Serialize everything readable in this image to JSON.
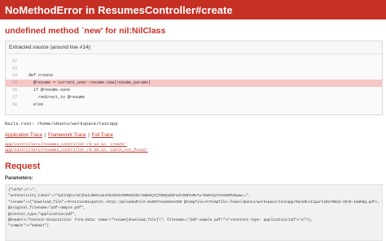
{
  "header": {
    "title": "NoMethodError in ResumesController#create"
  },
  "error": {
    "message": "undefined method `new' for nil:NilClass"
  },
  "source": {
    "title": "Extracted source (around line #14):",
    "lines": [
      {
        "num": "12",
        "code": ""
      },
      {
        "num": "13",
        "code": ""
      },
      {
        "num": "14",
        "code": "  def create"
      },
      {
        "num": "15",
        "code": "    @resume = current_user.resume.new(resume_params)"
      },
      {
        "num": "16",
        "code": "    if @resume.save"
      },
      {
        "num": "17",
        "code": "      redirect_to @resume"
      },
      {
        "num": "18",
        "code": "    else"
      }
    ]
  },
  "rails_root": "Rails.root: /home/ubuntu/workspace/testapp",
  "trace": {
    "app_label": "Application Trace",
    "framework_label": "Framework Trace",
    "full_label": "Full Trace",
    "sep": "|",
    "lines": [
      "app/controllers/resumes_controller.rb:14:in `create'",
      "app/controllers/resumes_controller.rb:40:in `catch_not_found'"
    ]
  },
  "request": {
    "title": "Request",
    "params_label": "Parameters:",
    "params_lines": [
      "{\"utf8\"=>\"✓\",",
      " \"authenticity_token\"=>\"tpCiIQru/UnjhuiJKDCc2a4tbz02dJZ9MnO23S/2mN20jSjTBHQ1mbFvdrZ8N7uRvTu/6URcGpTaTe6hMVOpww==\",",
      " \"resume\"=>{\"download_file\"=>#<ActionDispatch::Http::UploadedFile:0x0077a1e01eeC60 @tempfile=#<Tempfile:/home/ubuntu/workspace/testapp/RackMultipart20170823-3578-1m4b9g.pdf>,",
      " @original_filename=\"pdf-sample.pdf\",",
      " @content_type=\"application/pdf\",",
      " @headers=\"Content-Disposition: form-data; name=\\\"resume[download_file]\\\"; filename=\\\"pdf-sample.pdf\\\"\\r\\nContent-Type: application/pdf\\r\\n\">},",
      " \"commit\"=>\"Submit\"}"
    ]
  }
}
